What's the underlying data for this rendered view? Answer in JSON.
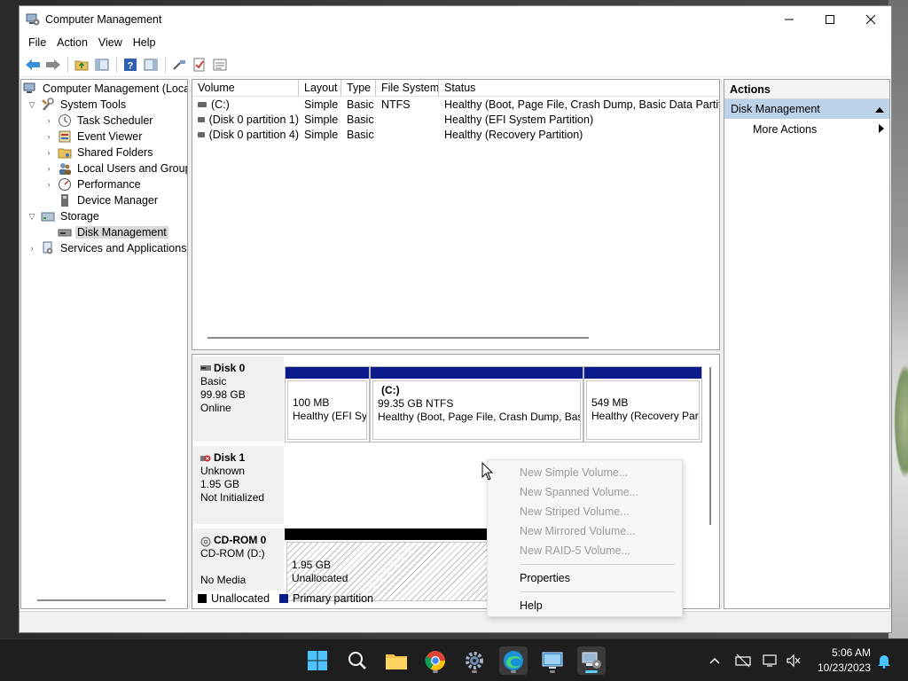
{
  "window": {
    "title": "Computer Management",
    "min_glyph": "—",
    "close_glyph": "✕"
  },
  "menu": [
    "File",
    "Action",
    "View",
    "Help"
  ],
  "tree": {
    "root": "Computer Management (Local",
    "system_tools": "System Tools",
    "task_scheduler": "Task Scheduler",
    "event_viewer": "Event Viewer",
    "shared_folders": "Shared Folders",
    "local_users": "Local Users and Groups",
    "performance": "Performance",
    "device_manager": "Device Manager",
    "storage": "Storage",
    "disk_management": "Disk Management",
    "services": "Services and Applications"
  },
  "volume_list": {
    "columns": [
      "Volume",
      "Layout",
      "Type",
      "File System",
      "Status"
    ],
    "rows": [
      {
        "volume": "(C:)",
        "layout": "Simple",
        "type": "Basic",
        "fs": "NTFS",
        "status": "Healthy (Boot, Page File, Crash Dump, Basic Data Partition)"
      },
      {
        "volume": "(Disk 0 partition 1)",
        "layout": "Simple",
        "type": "Basic",
        "fs": "",
        "status": "Healthy (EFI System Partition)"
      },
      {
        "volume": "(Disk 0 partition 4)",
        "layout": "Simple",
        "type": "Basic",
        "fs": "",
        "status": "Healthy (Recovery Partition)"
      }
    ]
  },
  "disks": {
    "disk0": {
      "name": "Disk 0",
      "type": "Basic",
      "size": "99.98 GB",
      "state": "Online",
      "p1": {
        "size": "100 MB",
        "status": "Healthy (EFI Sys"
      },
      "p2": {
        "name": "(C:)",
        "size": "99.35 GB NTFS",
        "status": "Healthy (Boot, Page File, Crash Dump, Basi"
      },
      "p3": {
        "size": "549 MB",
        "status": "Healthy (Recovery Part"
      }
    },
    "disk1": {
      "name": "Disk 1",
      "type": "Unknown",
      "size": "1.95 GB",
      "state": "Not Initialized",
      "unalloc": {
        "size": "1.95 GB",
        "label": "Unallocated"
      }
    },
    "cdrom": {
      "name": "CD-ROM 0",
      "drive": "CD-ROM (D:)",
      "media": "No Media"
    }
  },
  "legend": {
    "unallocated": "Unallocated",
    "primary": "Primary partition"
  },
  "actions": {
    "header": "Actions",
    "section": "Disk Management",
    "more": "More Actions"
  },
  "context_menu": {
    "new_simple": "New Simple Volume...",
    "new_spanned": "New Spanned Volume...",
    "new_striped": "New Striped Volume...",
    "new_mirrored": "New Mirrored Volume...",
    "new_raid5": "New RAID-5 Volume...",
    "properties": "Properties",
    "help": "Help"
  },
  "taskbar": {
    "time": "5:06 AM",
    "date": "10/23/2023"
  },
  "colors": {
    "primary_partition": "#0b1b8c",
    "unallocated": "#000000",
    "selection": "#bcd2e8",
    "taskbar": "#1e1e1e"
  }
}
